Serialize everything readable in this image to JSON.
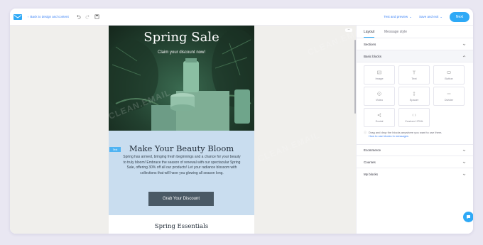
{
  "topbar": {
    "back_label": "Back to design and content",
    "test_label": "Test and preview",
    "save_label": "Save and exit",
    "next_label": "Next"
  },
  "email": {
    "hero_title": "Spring Sale",
    "hero_subtitle": "Claim your discount now!",
    "text_tag": "Text",
    "promo_title": "Make Your Beauty Bloom",
    "promo_body": "Spring has arrived, bringing fresh beginnings and a chance for your beauty to truly bloom! Embrace the season of renewal with our spectacular Spring Sale, offering 30% off all our products! Let your radiance blossom with collections that will have you glowing all season long.",
    "cta_label": "Grab Your Discount",
    "essentials_title": "Spring Essentials"
  },
  "panel": {
    "tabs": [
      "Layout",
      "Message style"
    ],
    "sections_label": "Sections",
    "basic_blocks_label": "Basic blocks",
    "blocks": [
      {
        "label": "Image",
        "icon": "image-icon"
      },
      {
        "label": "Text",
        "icon": "text-icon"
      },
      {
        "label": "Button",
        "icon": "button-icon"
      },
      {
        "label": "Video",
        "icon": "video-icon"
      },
      {
        "label": "Spacer",
        "icon": "spacer-icon"
      },
      {
        "label": "Divider",
        "icon": "divider-icon"
      },
      {
        "label": "Social",
        "icon": "social-icon"
      },
      {
        "label": "Custom HTML",
        "icon": "code-icon"
      }
    ],
    "hint_text": "Drag and drop the blocks anywhere you want to use them.",
    "hint_link": "How to use blocks in messages",
    "collapsed_sections": [
      "Ecommerce",
      "Courses",
      "My blocks"
    ]
  },
  "watermark": "CLEAN.EMAIL",
  "colors": {
    "accent": "#2ea9f6",
    "promo_bg": "#c9ddef",
    "cta_bg": "#4a5965"
  }
}
